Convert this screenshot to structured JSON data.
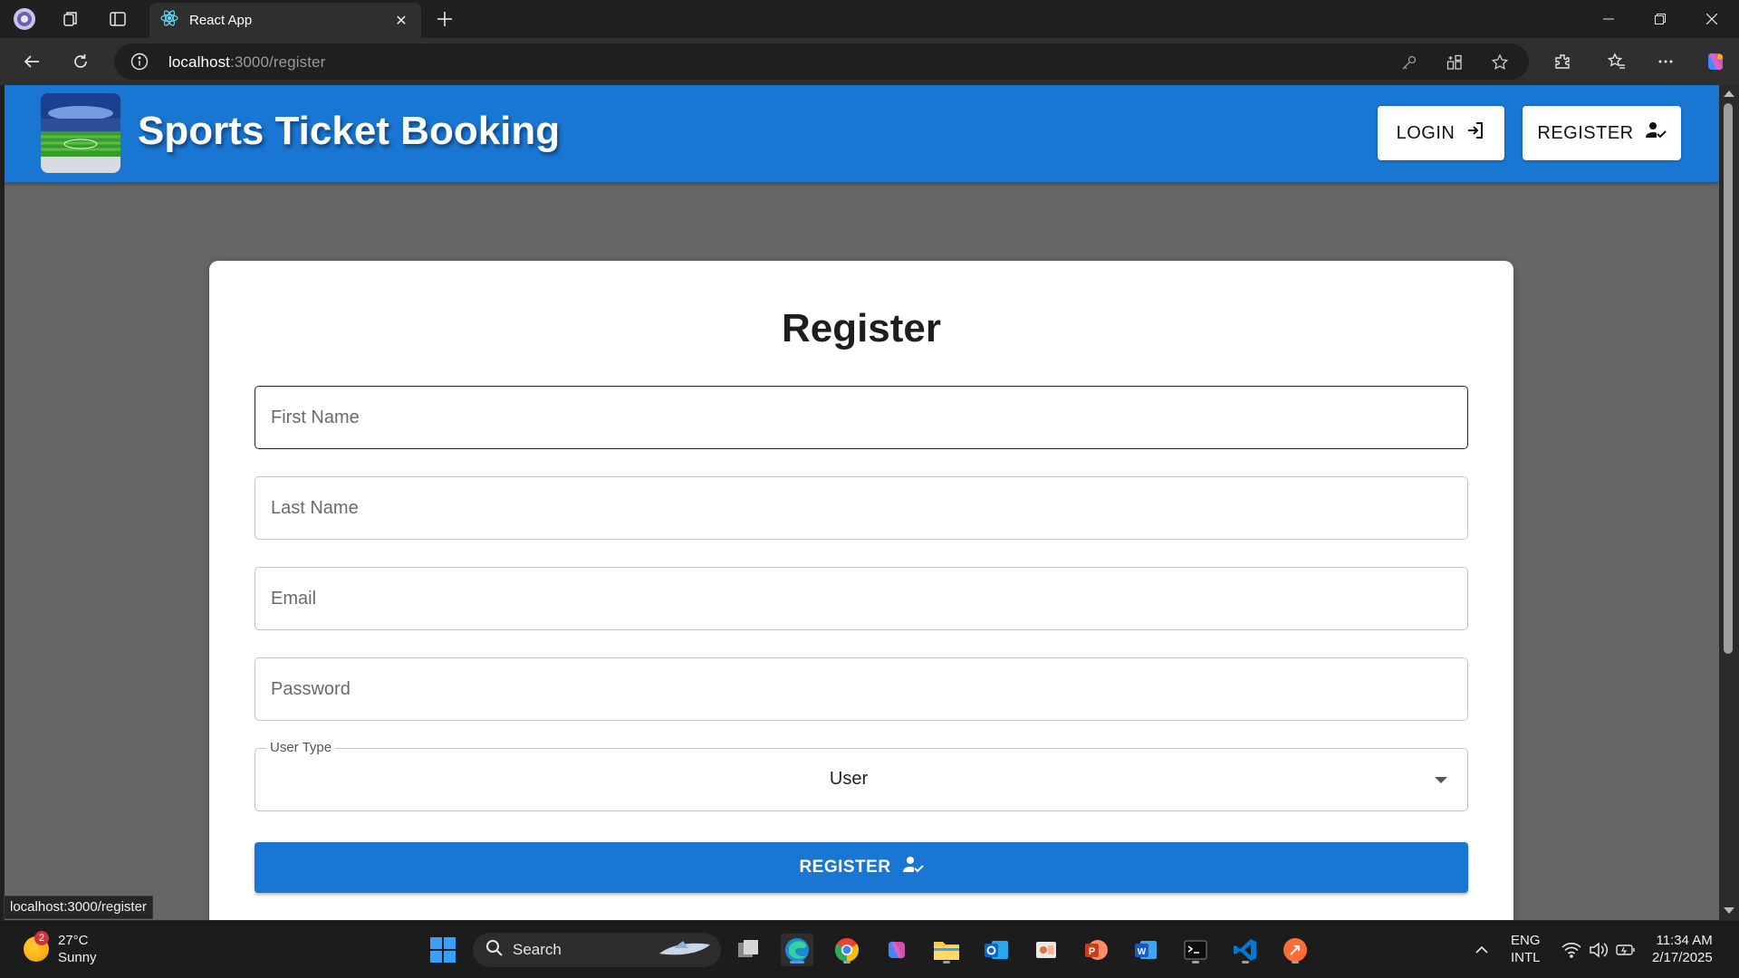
{
  "browser": {
    "tab_title": "React App",
    "url_host": "localhost",
    "url_path": ":3000/register"
  },
  "header": {
    "brand": "Sports Ticket Booking",
    "login_label": "LOGIN",
    "register_label": "REGISTER"
  },
  "form": {
    "title": "Register",
    "first_name_placeholder": "First Name",
    "last_name_placeholder": "Last Name",
    "email_placeholder": "Email",
    "password_placeholder": "Password",
    "user_type_label": "User Type",
    "user_type_value": "User",
    "submit_label": "REGISTER"
  },
  "status_link": "localhost:3000/register",
  "taskbar": {
    "weather_temp": "27°C",
    "weather_desc": "Sunny",
    "weather_badge": "2",
    "search_label": "Search",
    "lang_top": "ENG",
    "lang_bottom": "INTL",
    "time": "11:34 AM",
    "date": "2/17/2025"
  },
  "colors": {
    "primary": "#1976d2",
    "page_backdrop": "#666666"
  }
}
